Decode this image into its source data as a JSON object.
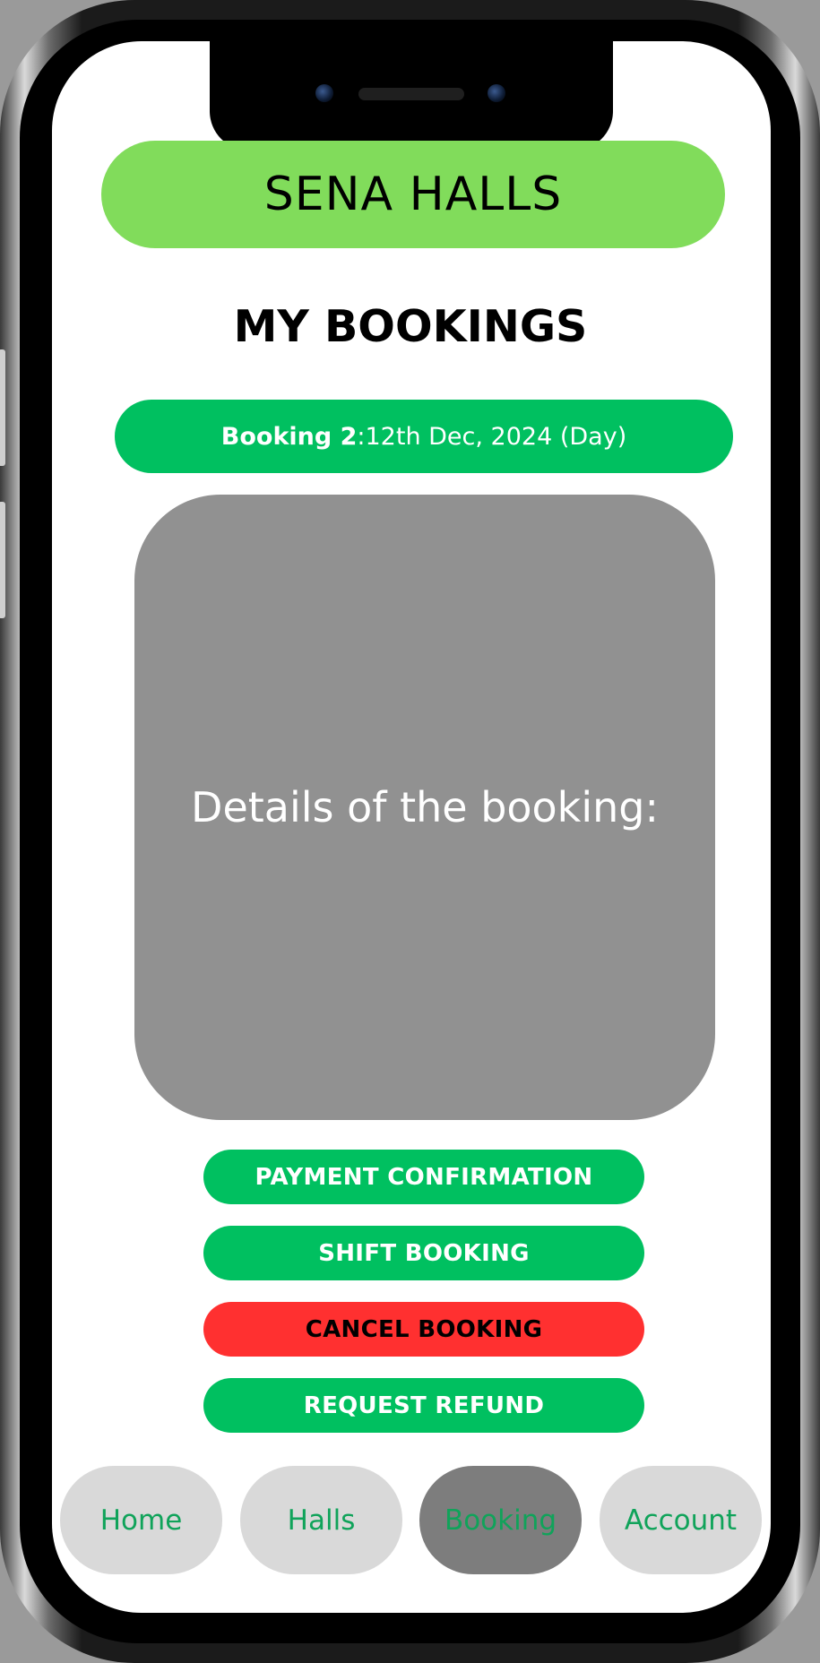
{
  "app": {
    "brand": "SENA HALLS"
  },
  "page": {
    "title": "MY BOOKINGS"
  },
  "booking": {
    "label": "Booking 2",
    "separator": ": ",
    "date": "12th Dec, 2024 (Day)"
  },
  "details": {
    "heading": "Details of the booking:"
  },
  "actions": {
    "payment_confirmation": "PAYMENT CONFIRMATION",
    "shift_booking": "SHIFT BOOKING",
    "cancel_booking": "CANCEL BOOKING",
    "request_refund": "REQUEST REFUND"
  },
  "nav": {
    "items": [
      {
        "label": "Home"
      },
      {
        "label": "Halls"
      },
      {
        "label": "Booking"
      },
      {
        "label": "Account"
      }
    ],
    "active": "Booking"
  },
  "colors": {
    "brand_green": "#81dc5b",
    "primary_green": "#00c060",
    "danger_red": "#ff3030",
    "card_gray": "#919191",
    "nav_gray": "#d9d9d9",
    "nav_active_gray": "#7d7d7d",
    "nav_text_green": "#10a35a"
  }
}
